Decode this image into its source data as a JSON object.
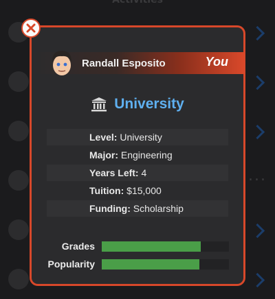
{
  "background": {
    "header": "Activities",
    "rows": 6
  },
  "modal": {
    "user": {
      "name": "Randall Esposito",
      "tag": "You"
    },
    "title": "University",
    "title_icon": "university-building-icon",
    "info": [
      {
        "key": "Level:",
        "value": "University"
      },
      {
        "key": "Major:",
        "value": "Engineering"
      },
      {
        "key": "Years Left:",
        "value": "4"
      },
      {
        "key": "Tuition:",
        "value": "$15,000"
      },
      {
        "key": "Funding:",
        "value": "Scholarship"
      }
    ],
    "stats": [
      {
        "label": "Grades",
        "percent": 78
      },
      {
        "label": "Popularity",
        "percent": 77
      }
    ]
  },
  "colors": {
    "accent": "#d8482a",
    "title": "#5fb0f0",
    "bar": "#4a9e48"
  }
}
